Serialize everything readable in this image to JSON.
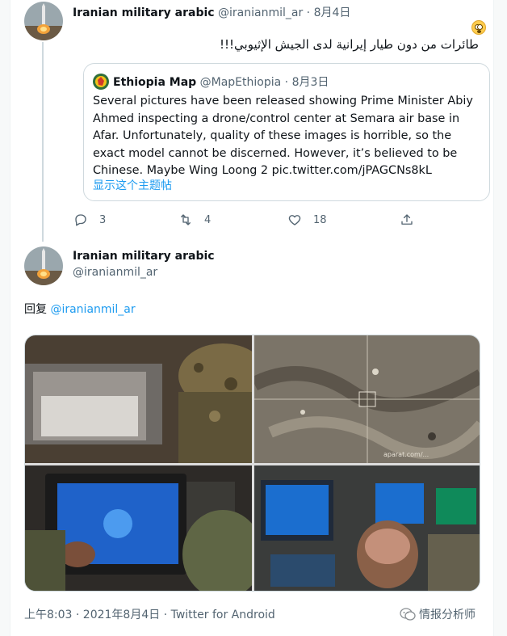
{
  "tweet": {
    "display_name": "Iranian military arabic",
    "handle": "@iranianmil_ar",
    "separator": "·",
    "date": "8月4日",
    "arabic_text": "طائرات من دون طيار إيرانية لدى الجيش الإثيوبي!!!",
    "emoji": "flushed-face-emoji"
  },
  "quoted": {
    "display_name": "Ethiopia Map",
    "handle": "@MapEthiopia",
    "separator": "·",
    "date": "8月3日",
    "text": "Several pictures have been released showing Prime Minister Abiy Ahmed inspecting a drone/control center at Semara air base in Afar. Unfortunately, quality of these images is horrible, so the exact model cannot be discerned. However, it’s believed to be Chinese. Maybe Wing Loong 2 pic.twitter.com/jPAGCNs8kL",
    "show_thread": "显示这个主题帖"
  },
  "actions": {
    "reply_count": "3",
    "retweet_count": "4",
    "like_count": "18"
  },
  "reply": {
    "display_name": "Iranian military arabic",
    "handle": "@iranianmil_ar",
    "reply_label": "回复",
    "reply_handle": "@iranianmil_ar",
    "timestamp": "上午8:03 · 2021年8月4日 · Twitter for Android",
    "photo_watermark": "aparat.com/..."
  },
  "watermark": {
    "label": "情报分析师"
  },
  "colors": {
    "link": "#1d9bf0",
    "muted": "#536471",
    "border": "#cfd9de",
    "text": "#0f1419"
  }
}
